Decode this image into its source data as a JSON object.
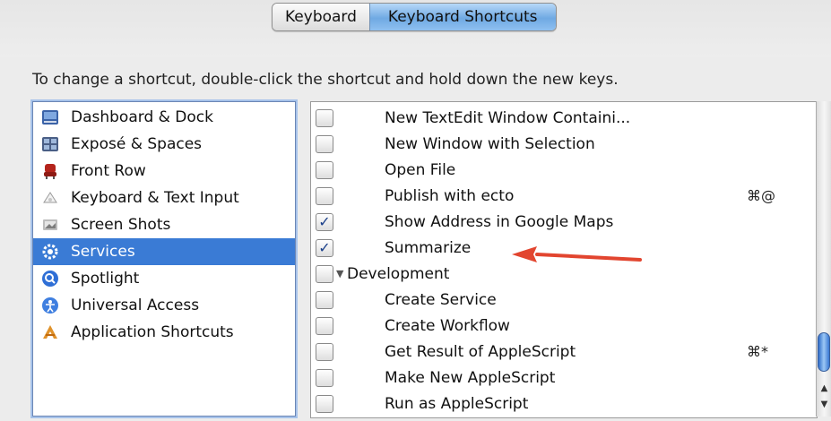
{
  "tabs": [
    {
      "label": "Keyboard",
      "selected": false
    },
    {
      "label": "Keyboard Shortcuts",
      "selected": true
    }
  ],
  "instructions": "To change a shortcut, double-click the shortcut and hold down the new keys.",
  "categories": [
    {
      "label": "Dashboard & Dock",
      "icon": "dashboard-dock-icon",
      "selected": false
    },
    {
      "label": "Exposé & Spaces",
      "icon": "expose-spaces-icon",
      "selected": false
    },
    {
      "label": "Front Row",
      "icon": "front-row-icon",
      "selected": false
    },
    {
      "label": "Keyboard & Text Input",
      "icon": "keyboard-text-input-icon",
      "selected": false
    },
    {
      "label": "Screen Shots",
      "icon": "screen-shots-icon",
      "selected": false
    },
    {
      "label": "Services",
      "icon": "services-gear-icon",
      "selected": true
    },
    {
      "label": "Spotlight",
      "icon": "spotlight-icon",
      "selected": false
    },
    {
      "label": "Universal Access",
      "icon": "universal-access-icon",
      "selected": false
    },
    {
      "label": "Application Shortcuts",
      "icon": "application-shortcuts-icon",
      "selected": false
    }
  ],
  "shortcuts": [
    {
      "label": "New TextEdit Window Containi...",
      "checked": false,
      "shortcut": "",
      "group": false
    },
    {
      "label": "New Window with Selection",
      "checked": false,
      "shortcut": "",
      "group": false
    },
    {
      "label": "Open File",
      "checked": false,
      "shortcut": "",
      "group": false
    },
    {
      "label": "Publish with ecto",
      "checked": false,
      "shortcut": "⌘@",
      "group": false
    },
    {
      "label": "Show Address in Google Maps",
      "checked": true,
      "shortcut": "",
      "group": false
    },
    {
      "label": "Summarize",
      "checked": true,
      "shortcut": "",
      "group": false
    },
    {
      "label": "Development",
      "checked": false,
      "shortcut": "",
      "group": true
    },
    {
      "label": "Create Service",
      "checked": false,
      "shortcut": "",
      "group": false
    },
    {
      "label": "Create Workflow",
      "checked": false,
      "shortcut": "",
      "group": false
    },
    {
      "label": "Get Result of AppleScript",
      "checked": false,
      "shortcut": "⌘*",
      "group": false
    },
    {
      "label": "Make New AppleScript",
      "checked": false,
      "shortcut": "",
      "group": false
    },
    {
      "label": "Run as AppleScript",
      "checked": false,
      "shortcut": "",
      "group": false
    }
  ],
  "annotation": {
    "icon": "red-arrow-icon",
    "color": "#e2452f"
  },
  "colors": {
    "selection": "#3a7bd5",
    "tab_selected": "#6fa9e3",
    "checkmark": "#1a3f8a"
  }
}
